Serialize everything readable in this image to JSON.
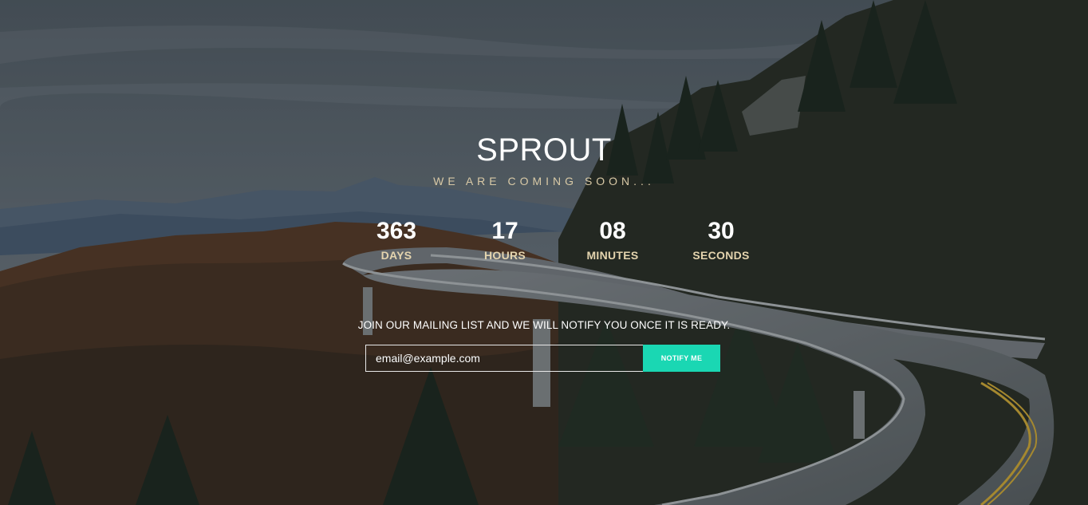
{
  "hero": {
    "title": "SPROUT",
    "subtitle": "WE ARE COMING SOON..."
  },
  "countdown": [
    {
      "value": "363",
      "label": "DAYS"
    },
    {
      "value": "17",
      "label": "HOURS"
    },
    {
      "value": "08",
      "label": "MINUTES"
    },
    {
      "value": "30",
      "label": "SECONDS"
    }
  ],
  "mailing": {
    "text": "JOIN OUR MAILING LIST AND WE WILL NOTIFY YOU ONCE IT IS READY.",
    "email_placeholder": "email@example.com",
    "button_label": "NOTIFY ME"
  },
  "colors": {
    "accent": "#1ad7b3",
    "label": "#e4d4ae",
    "subtitle": "#d8c9a6"
  }
}
